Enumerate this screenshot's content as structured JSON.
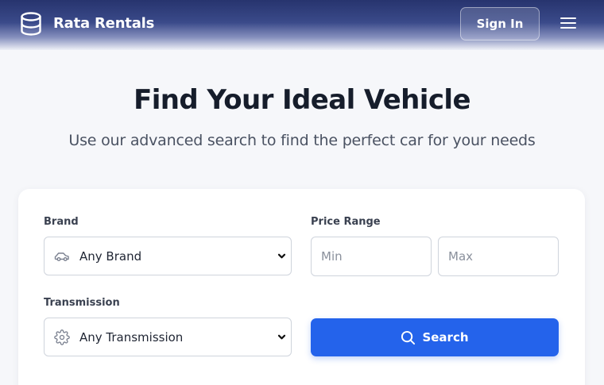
{
  "header": {
    "brand": "Rata Rentals",
    "logo_icon": "database-icon",
    "sign_in_label": "Sign In",
    "menu_icon": "hamburger-menu-icon"
  },
  "hero": {
    "title": "Find Your Ideal Vehicle",
    "subtitle": "Use our advanced search to find the perfect car for your needs"
  },
  "search_form": {
    "brand": {
      "label": "Brand",
      "selected": "Any Brand",
      "icon": "car-icon"
    },
    "price_range": {
      "label": "Price Range",
      "min_placeholder": "Min",
      "max_placeholder": "Max"
    },
    "transmission": {
      "label": "Transmission",
      "selected": "Any Transmission",
      "icon": "gear-icon"
    },
    "search_button_label": "Search",
    "search_icon": "search-icon"
  },
  "colors": {
    "header_dark": "#27346e",
    "primary": "#2463eb",
    "page_background": "#f6f7fa",
    "title_text": "#161d2b"
  }
}
